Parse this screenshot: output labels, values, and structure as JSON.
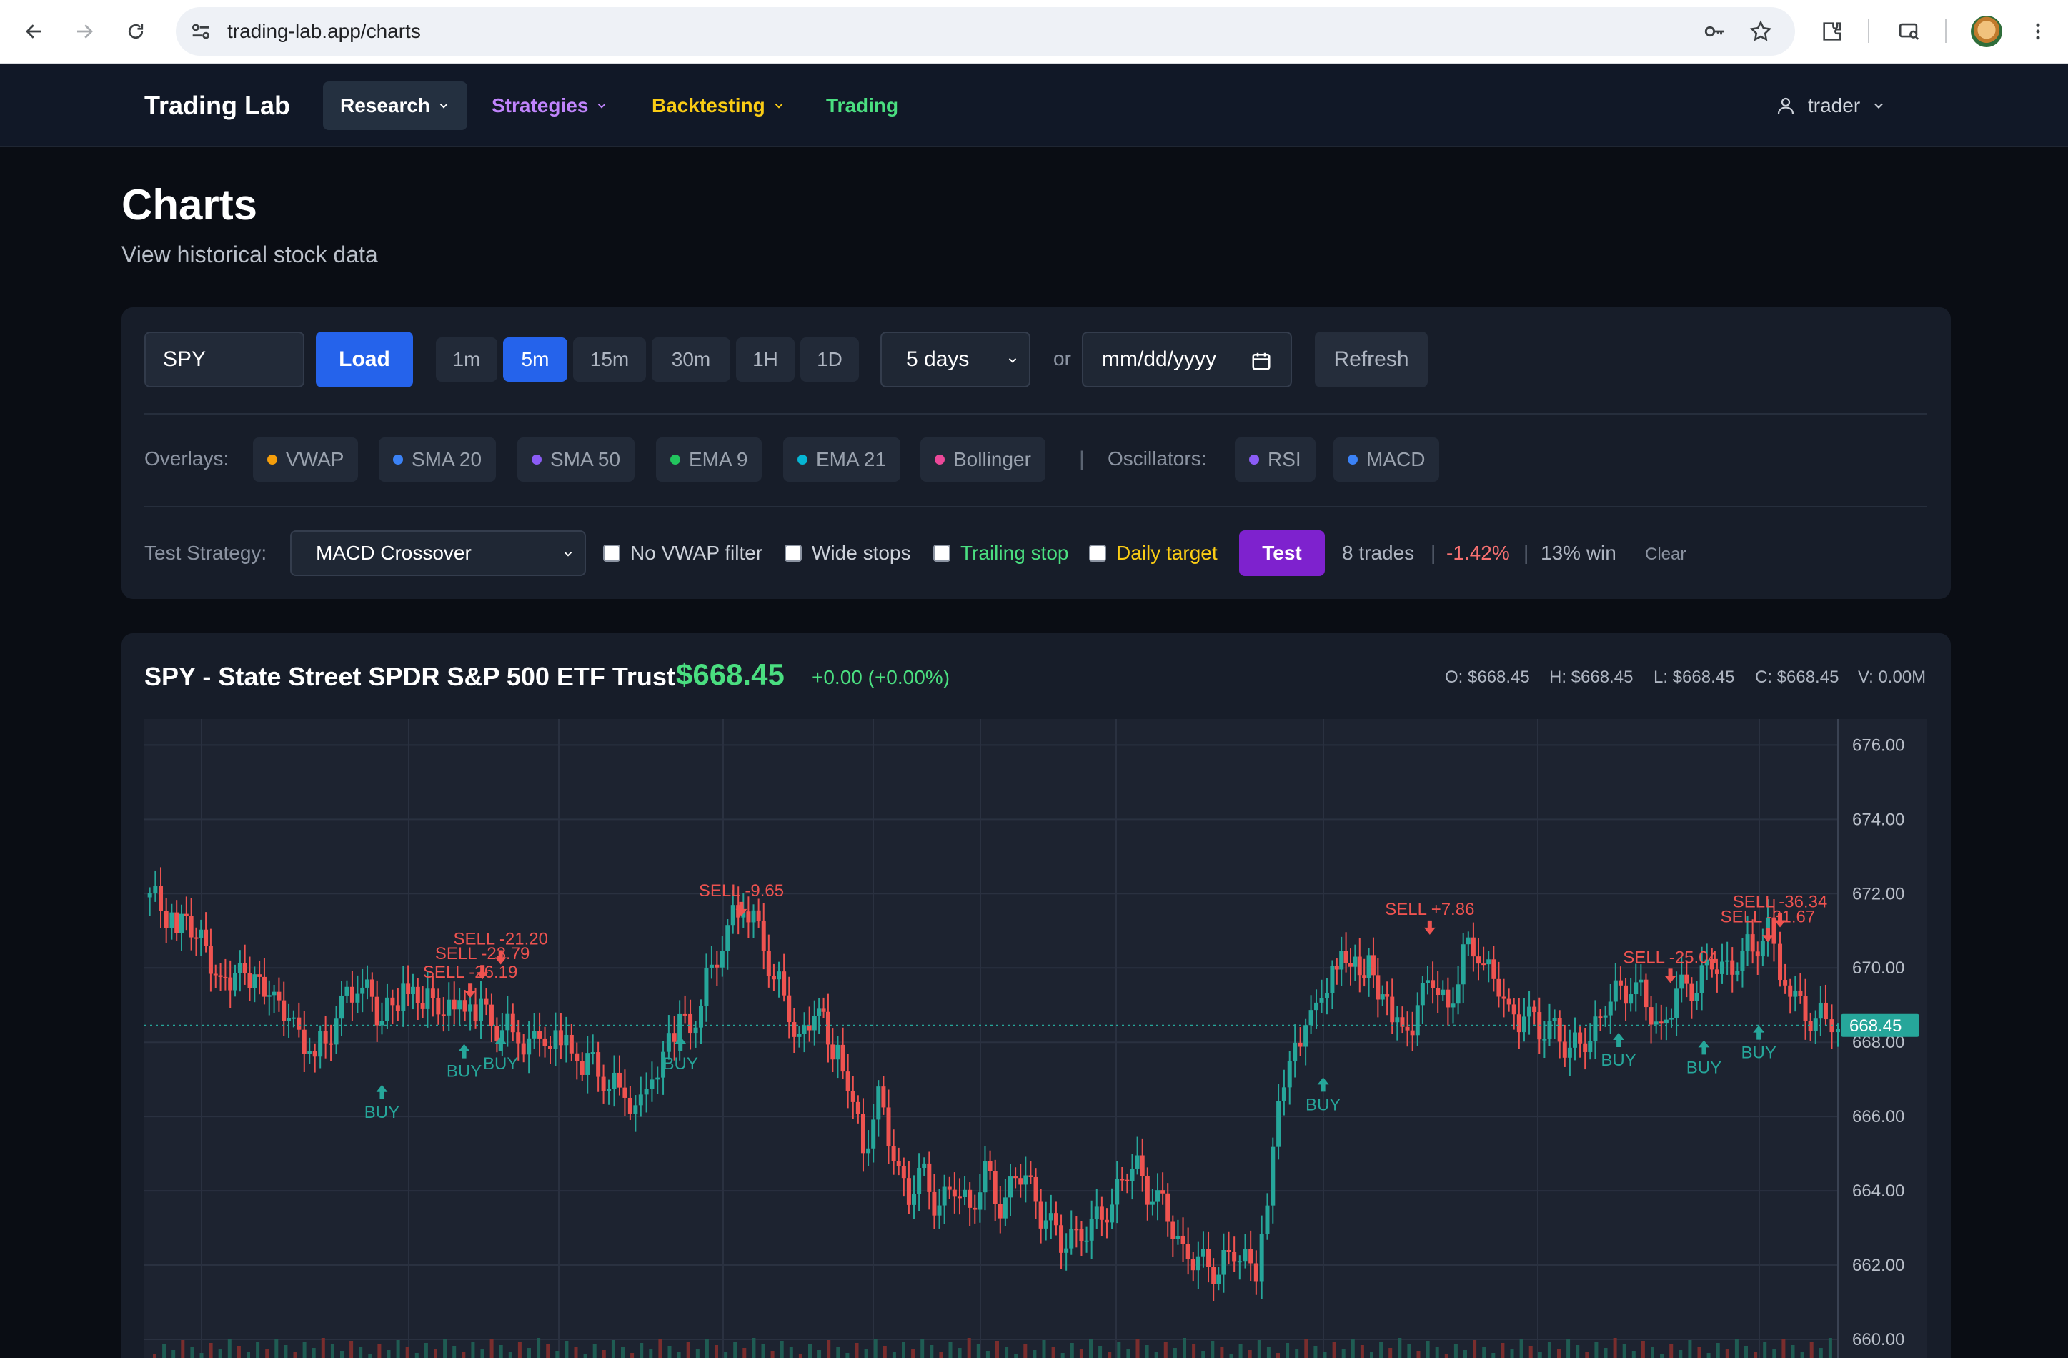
{
  "browser": {
    "url": "trading-lab.app/charts"
  },
  "header": {
    "brand": "Trading Lab",
    "nav": [
      {
        "label": "Research",
        "color": "#ffffff"
      },
      {
        "label": "Strategies",
        "color": "#c084fc"
      },
      {
        "label": "Backtesting",
        "color": "#facc15"
      },
      {
        "label": "Trading",
        "color": "#4ade80"
      }
    ],
    "user": "trader"
  },
  "page": {
    "title": "Charts",
    "subtitle": "View historical stock data"
  },
  "controls": {
    "symbol_value": "SPY",
    "load_label": "Load",
    "timeframes": [
      "1m",
      "5m",
      "15m",
      "30m",
      "1H",
      "1D"
    ],
    "active_timeframe": "5m",
    "range_value": "5 days",
    "or_label": "or",
    "date_placeholder": "mm/dd/yyyy",
    "refresh_label": "Refresh"
  },
  "indicators": {
    "overlays_label": "Overlays:",
    "overlays": [
      {
        "label": "VWAP",
        "color": "#f59e0b"
      },
      {
        "label": "SMA 20",
        "color": "#3b82f6"
      },
      {
        "label": "SMA 50",
        "color": "#8b5cf6"
      },
      {
        "label": "EMA 9",
        "color": "#22c55e"
      },
      {
        "label": "EMA 21",
        "color": "#06b6d4"
      },
      {
        "label": "Bollinger",
        "color": "#ec4899"
      }
    ],
    "separator": "|",
    "oscillators_label": "Oscillators:",
    "oscillators": [
      {
        "label": "RSI",
        "color": "#8b5cf6"
      },
      {
        "label": "MACD",
        "color": "#3b82f6"
      }
    ]
  },
  "strategy": {
    "label": "Test Strategy:",
    "selected": "MACD Crossover",
    "options": [
      {
        "label": "No VWAP filter",
        "color": "#cdd2da"
      },
      {
        "label": "Wide stops",
        "color": "#cdd2da"
      },
      {
        "label": "Trailing stop",
        "color": "#4ade80"
      },
      {
        "label": "Daily target",
        "color": "#facc15"
      }
    ],
    "test_label": "Test",
    "results": {
      "trades": "8 trades",
      "sep": "|",
      "pnl": "-1.42%",
      "win": "13% win"
    },
    "clear_label": "Clear"
  },
  "chart_header": {
    "title": "SPY - State Street SPDR S&P 500 ETF Trust",
    "price": "$668.45",
    "change": "+0.00 (+0.00%)",
    "ohlc": {
      "open": "O: $668.45",
      "high": "H: $668.45",
      "low": "L: $668.45",
      "close": "C: $668.45",
      "volume": "V: 0.00M"
    }
  },
  "chart_data": {
    "type": "candlestick",
    "ylim": [
      659.5,
      676.7
    ],
    "y_ticks": [
      "676.00",
      "674.00",
      "672.00",
      "670.00",
      "668.00",
      "666.00",
      "664.00",
      "662.00",
      "660.00"
    ],
    "last_price": 668.45,
    "last_price_label": "668.45",
    "colors": {
      "up": "#26a69a",
      "down": "#ef5350",
      "buy": "#26a69a",
      "sell": "#ef5350"
    },
    "price_path": [
      [
        0,
        671.9
      ],
      [
        18,
        671.5
      ],
      [
        34,
        670.8
      ],
      [
        50,
        669.6
      ],
      [
        66,
        670.1
      ],
      [
        82,
        669.2
      ],
      [
        98,
        668.4
      ],
      [
        112,
        667.5
      ],
      [
        126,
        668.6
      ],
      [
        140,
        669.7
      ],
      [
        156,
        668.8
      ],
      [
        170,
        669.5
      ],
      [
        186,
        669.1
      ],
      [
        200,
        668.7
      ],
      [
        214,
        669.0
      ],
      [
        228,
        668.6
      ],
      [
        242,
        668.1
      ],
      [
        256,
        667.8
      ],
      [
        270,
        668.0
      ],
      [
        284,
        667.6
      ],
      [
        298,
        667.2
      ],
      [
        312,
        666.5
      ],
      [
        326,
        666.1
      ],
      [
        348,
        668.3
      ],
      [
        362,
        668.5
      ],
      [
        376,
        670.4
      ],
      [
        390,
        671.5
      ],
      [
        400,
        671.3
      ],
      [
        410,
        670.3
      ],
      [
        420,
        669.0
      ],
      [
        430,
        668.1
      ],
      [
        440,
        668.8
      ],
      [
        452,
        668.0
      ],
      [
        462,
        666.8
      ],
      [
        472,
        665.3
      ],
      [
        482,
        666.3
      ],
      [
        492,
        665.0
      ],
      [
        502,
        663.9
      ],
      [
        512,
        664.4
      ],
      [
        522,
        663.6
      ],
      [
        532,
        664.0
      ],
      [
        542,
        663.7
      ],
      [
        552,
        664.3
      ],
      [
        562,
        663.6
      ],
      [
        572,
        664.5
      ],
      [
        582,
        664.0
      ],
      [
        592,
        663.3
      ],
      [
        602,
        662.5
      ],
      [
        612,
        663.0
      ],
      [
        622,
        662.8
      ],
      [
        632,
        663.6
      ],
      [
        642,
        664.3
      ],
      [
        652,
        664.6
      ],
      [
        662,
        663.9
      ],
      [
        672,
        663.3
      ],
      [
        682,
        662.5
      ],
      [
        692,
        661.9
      ],
      [
        702,
        662.0
      ],
      [
        712,
        662.2
      ],
      [
        730,
        662.1
      ],
      [
        752,
        667.8
      ],
      [
        766,
        668.4
      ],
      [
        780,
        669.8
      ],
      [
        792,
        670.2
      ],
      [
        804,
        670.0
      ],
      [
        816,
        669.1
      ],
      [
        826,
        668.0
      ],
      [
        836,
        669.1
      ],
      [
        846,
        669.6
      ],
      [
        856,
        669.0
      ],
      [
        866,
        670.2
      ],
      [
        876,
        670.5
      ],
      [
        886,
        669.8
      ],
      [
        896,
        668.6
      ],
      [
        906,
        668.9
      ],
      [
        916,
        668.2
      ],
      [
        926,
        668.6
      ],
      [
        936,
        667.5
      ],
      [
        946,
        668.2
      ],
      [
        956,
        668.6
      ],
      [
        966,
        669.3
      ],
      [
        976,
        669.6
      ],
      [
        986,
        669.0
      ],
      [
        996,
        668.4
      ],
      [
        1006,
        669.2
      ],
      [
        1016,
        669.6
      ],
      [
        1026,
        670.0
      ],
      [
        1036,
        669.9
      ],
      [
        1046,
        670.3
      ],
      [
        1056,
        670.4
      ],
      [
        1066,
        671.2
      ],
      [
        1074,
        669.9
      ],
      [
        1084,
        669.0
      ],
      [
        1094,
        668.8
      ],
      [
        1104,
        668.5
      ],
      [
        1112,
        668.45
      ]
    ],
    "signals": [
      {
        "type": "buy",
        "x": 156,
        "y": 667.2,
        "label": "BUY"
      },
      {
        "type": "buy",
        "x": 210,
        "y": 668.3,
        "label": "BUY"
      },
      {
        "type": "buy",
        "x": 234,
        "y": 668.5,
        "label": "BUY"
      },
      {
        "type": "sell",
        "x": 222,
        "y": 669.5,
        "label": "SELL -23.79"
      },
      {
        "type": "sell",
        "x": 234,
        "y": 669.9,
        "label": "SELL -21.20"
      },
      {
        "type": "sell",
        "x": 214,
        "y": 669.0,
        "label": "SELL -26.19"
      },
      {
        "type": "buy",
        "x": 352,
        "y": 668.5,
        "label": "BUY"
      },
      {
        "type": "sell",
        "x": 392,
        "y": 671.2,
        "label": "SELL -9.65"
      },
      {
        "type": "buy",
        "x": 774,
        "y": 667.4,
        "label": "BUY"
      },
      {
        "type": "sell",
        "x": 844,
        "y": 670.7,
        "label": "SELL +7.86"
      },
      {
        "type": "sell",
        "x": 1002,
        "y": 669.4,
        "label": "SELL -25.04"
      },
      {
        "type": "buy",
        "x": 968,
        "y": 668.6,
        "label": "BUY"
      },
      {
        "type": "buy",
        "x": 1024,
        "y": 668.4,
        "label": "BUY"
      },
      {
        "type": "buy",
        "x": 1060,
        "y": 668.8,
        "label": "BUY"
      },
      {
        "type": "sell",
        "x": 1066,
        "y": 670.5,
        "label": "SELL -31.67"
      },
      {
        "type": "sell",
        "x": 1074,
        "y": 670.9,
        "label": "SELL -36.34"
      }
    ]
  }
}
